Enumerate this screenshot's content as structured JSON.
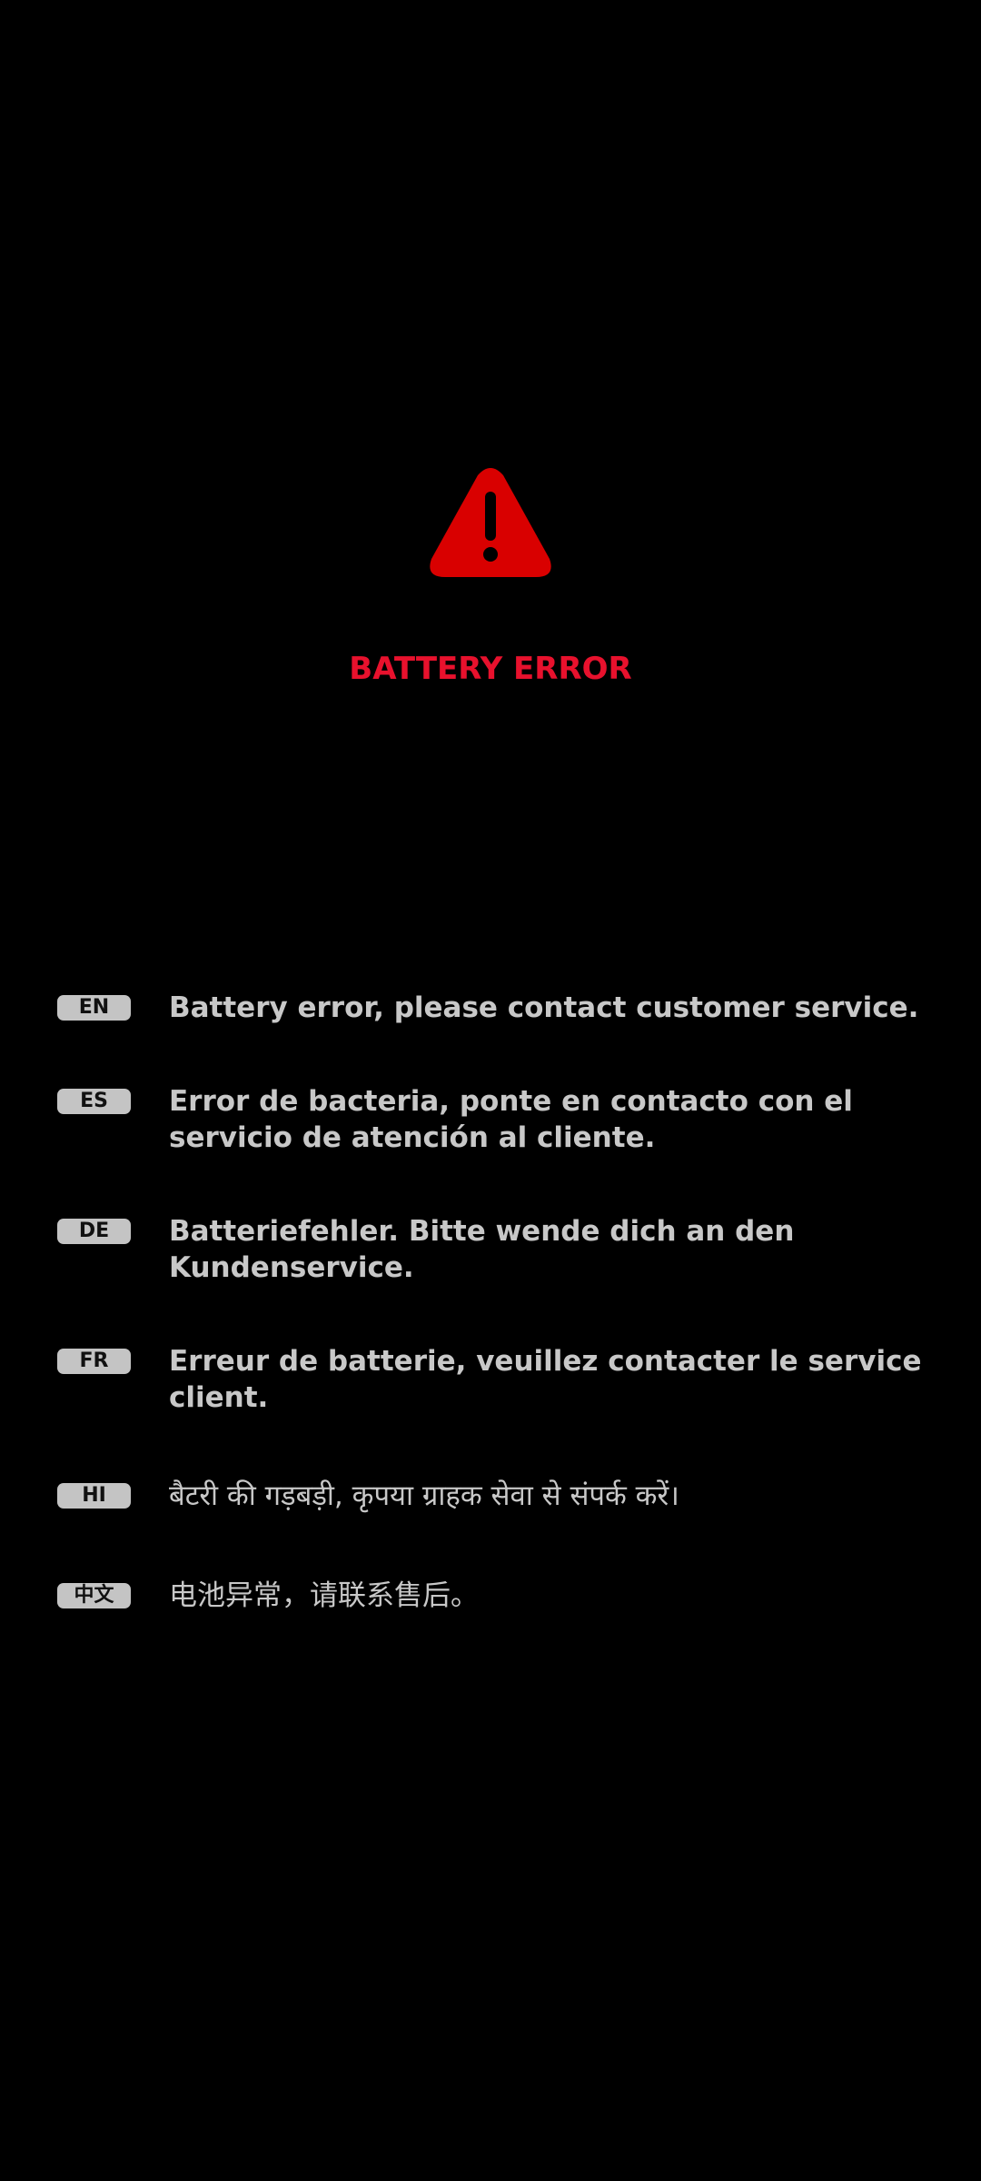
{
  "colors": {
    "background": "#000000",
    "accent_red": "#e8112d",
    "icon_red": "#d90000",
    "text_gray": "#c8c8c8",
    "badge_gray": "#c4c4c4"
  },
  "icon": "warning-triangle-icon",
  "title": "BATTERY ERROR",
  "messages": [
    {
      "lang": "EN",
      "text": "Battery error, please contact customer service."
    },
    {
      "lang": "ES",
      "text": "Error de bacteria, ponte en contacto con el servicio de atención al cliente."
    },
    {
      "lang": "DE",
      "text": "Batteriefehler. Bitte wende dich an den Kundenservice."
    },
    {
      "lang": "FR",
      "text": "Erreur de batterie, veuillez contacter le service client."
    },
    {
      "lang": "HI",
      "text": "बैटरी की गड़बड़ी, कृपया ग्राहक सेवा से संपर्क करें।"
    },
    {
      "lang": "中文",
      "text": "电池异常，请联系售后。"
    }
  ]
}
